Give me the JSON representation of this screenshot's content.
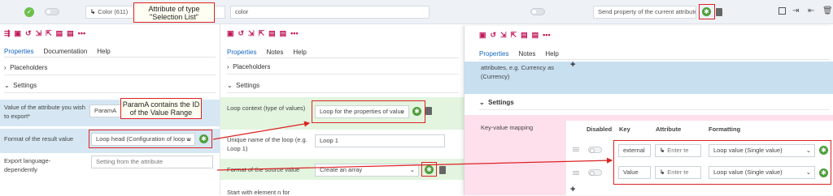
{
  "topbar": {
    "color_select": "Color (611)",
    "color_text": "color",
    "send_select": "Send property of the current attribute",
    "right_icons": [
      "window-icon",
      "export-icon",
      "import-icon",
      "trash-icon"
    ]
  },
  "callouts": {
    "selection_list": "Attribute of type \"Selection List\"",
    "param_a": "ParamA contains the ID of the Value Range"
  },
  "left_panel": {
    "tabs": [
      "Properties",
      "Documentation",
      "Help"
    ],
    "placeholders": "Placeholders",
    "settings": "Settings",
    "attr_label": "Value of the attribute you wish to export*",
    "attr_value": "ParamA",
    "format_label": "Format of the result value",
    "format_value": "Loop head (Configuration of loop w",
    "lang_label": "Export language-dependently",
    "lang_value": "Setting from the attribute"
  },
  "mid_panel": {
    "tabs": [
      "Properties",
      "Notes",
      "Help"
    ],
    "placeholders": "Placeholders",
    "settings": "Settings",
    "context_label": "Loop context (type of values)",
    "context_value": "Loop for the properties of value",
    "name_label": "Unique name of the loop (e.g. Loop 1)",
    "name_value": "Loop 1",
    "source_label": "Format of the source value",
    "source_value": "Create an array",
    "start_label": "Start with element n for"
  },
  "right_panel": {
    "tabs": [
      "Properties",
      "Notes",
      "Help"
    ],
    "desc_line1": "attributes, e.g. Currency as",
    "desc_line2": "(Currency)",
    "settings": "Settings",
    "kv_label": "Key-value mapping",
    "headers": {
      "disabled": "Disabled",
      "key": "Key",
      "attribute": "Attribute",
      "formatting": "Formatting"
    },
    "rows": [
      {
        "key": "external",
        "attribute": "Enter te",
        "formatting": "Loop value (Single value)"
      },
      {
        "key": "Value",
        "attribute": "Enter te",
        "formatting": "Loop value (Single value)"
      }
    ]
  },
  "colors": {
    "accent": "#c2185b",
    "green": "#4f9e3c",
    "red": "#d22222",
    "blue_row": "#c8dff0",
    "pink": "#fde0ec",
    "mint": "#e3f5df"
  }
}
